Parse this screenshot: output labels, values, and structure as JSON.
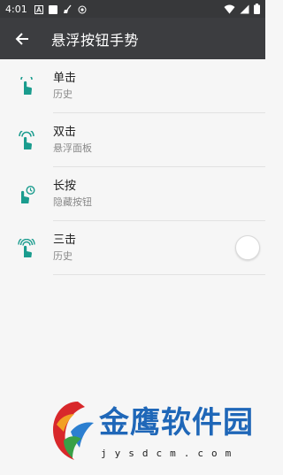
{
  "status_bar": {
    "time": "4:01"
  },
  "toolbar": {
    "title": "悬浮按钮手势"
  },
  "items": [
    {
      "title": "单击",
      "subtitle": "历史"
    },
    {
      "title": "双击",
      "subtitle": "悬浮面板"
    },
    {
      "title": "长按",
      "subtitle": "隐藏按钮"
    },
    {
      "title": "三击",
      "subtitle": "历史"
    }
  ],
  "watermark": {
    "name": "金鹰软件园",
    "url": "jysdcm.com"
  },
  "colors": {
    "accent": "#1a9c8e",
    "toolbar": "#3c3d40",
    "status_bar": "#37383a",
    "watermark": "#1f67b8"
  }
}
